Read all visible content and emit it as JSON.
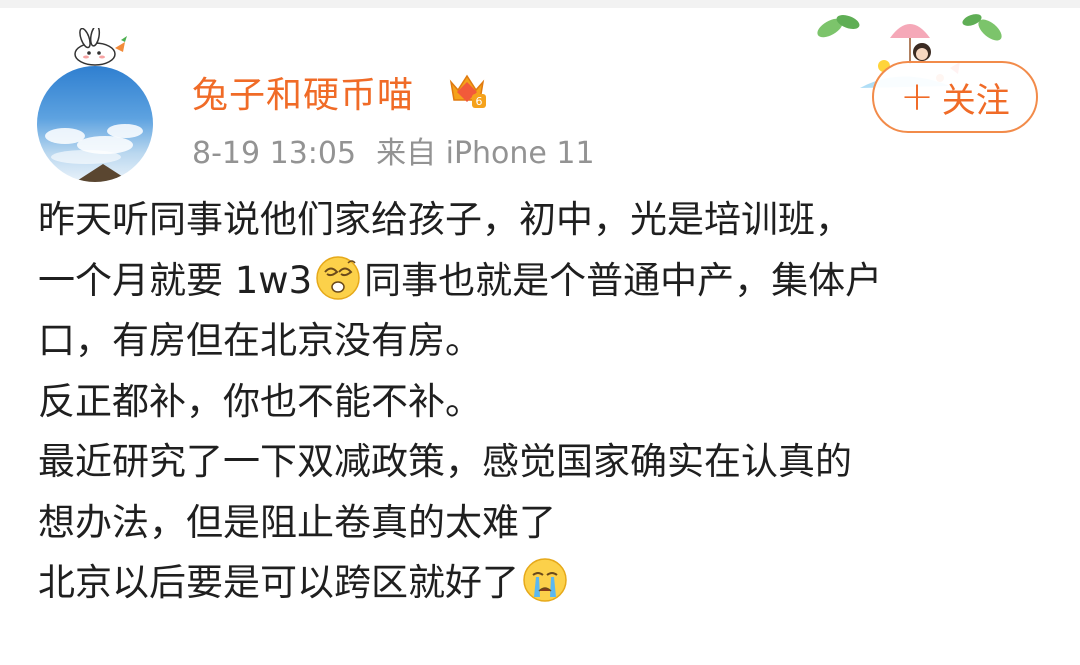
{
  "post": {
    "author": {
      "name": "兔子和硬币喵",
      "avatar_icon": "avatar-photo",
      "badge_icon": "vip-crown-icon",
      "badge_level": "6"
    },
    "meta": {
      "time": "8-19 13:05",
      "source": "来自 iPhone 11"
    },
    "follow": {
      "plus": "+",
      "label": "关注"
    },
    "colors": {
      "accent": "#f06b27",
      "meta_text": "#939393",
      "body_text": "#1f1f1f"
    },
    "lines": [
      {
        "text": "昨天听同事说他们家给孩子，初中，光是培训班，"
      },
      {
        "before": "一个月就要 1w3",
        "emoji": "dizzy-face-emoji",
        "after": "同事也就是个普通中产，集体户"
      },
      {
        "text": "口，有房但在北京没有房。"
      },
      {
        "text": "反正都补，你也不能不补。"
      },
      {
        "text": "最近研究了一下双减政策，感觉国家确实在认真的"
      },
      {
        "text": "想办法，但是阻止卷真的太难了"
      },
      {
        "before": "北京以后要是可以跨区就好了",
        "emoji": "crying-face-emoji",
        "after": ""
      }
    ]
  }
}
